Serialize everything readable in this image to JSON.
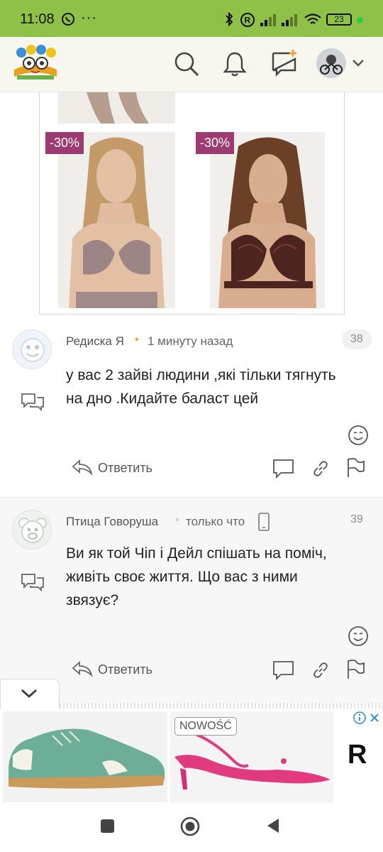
{
  "status": {
    "time": "11:08",
    "battery": "23",
    "icons": [
      "viber-icon",
      "more-icon",
      "bluetooth-icon",
      "registered-icon",
      "signal-icon",
      "signal-icon-2",
      "wifi-icon",
      "battery-icon",
      "dot-icon"
    ]
  },
  "appbar": {
    "icons": [
      "logo",
      "search-icon",
      "bell-icon",
      "new-post-icon",
      "avatar",
      "chevron-down-icon"
    ]
  },
  "post_images": {
    "badges": [
      "-30%",
      "-30%"
    ]
  },
  "comments": [
    {
      "author": "Редиска Я",
      "time": "1 минуту назад",
      "number": "38",
      "text_lines": [
        "у вас 2 зайві людини ,які тільки тягнуть",
        "на дно .Кидайте баласт цей"
      ],
      "reply_label": "Ответить"
    },
    {
      "author": "Птица Говоруша",
      "time": "только что",
      "number": "39",
      "text_lines": [
        "Ви як той Чіп і Дейл спішать на поміч,",
        "живіть своє життя. Що вас з ними",
        "звязує?"
      ],
      "reply_label": "Ответить"
    }
  ],
  "ad": {
    "badge": "NOWOŚĆ",
    "brand_letter": "R",
    "info_icon": "info-icon",
    "close_icon": "close-icon"
  },
  "colors": {
    "statusbar": "#8fc148",
    "badge": "#9d3a72",
    "appbar": "#f7f7ef",
    "accent_orange": "#f29a2e"
  }
}
